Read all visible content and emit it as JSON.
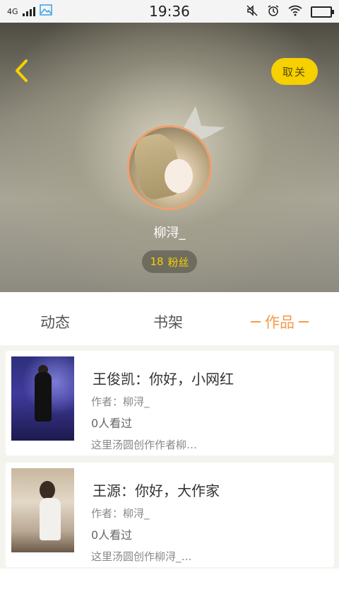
{
  "status_bar": {
    "network": "4G",
    "time": "19:36"
  },
  "header": {
    "unfollow_label": "取关",
    "username": "柳浔_",
    "fans_count": "18",
    "fans_label": "粉丝"
  },
  "tabs": [
    {
      "label": "动态",
      "active": false
    },
    {
      "label": "书架",
      "active": false
    },
    {
      "label": "作品",
      "active": true
    }
  ],
  "works": [
    {
      "title": "王俊凯：你好，小网红",
      "author": "作者：柳浔_",
      "views": "0人看过",
      "description": "这里汤圆创作作者柳…"
    },
    {
      "title": "王源：你好，大作家",
      "author": "作者：柳浔_",
      "views": "0人看过",
      "description": "这里汤圆创作柳浔_…"
    }
  ],
  "colors": {
    "accent_yellow": "#f6d000",
    "active_tab": "#f39a49",
    "avatar_border": "#f0a070"
  }
}
